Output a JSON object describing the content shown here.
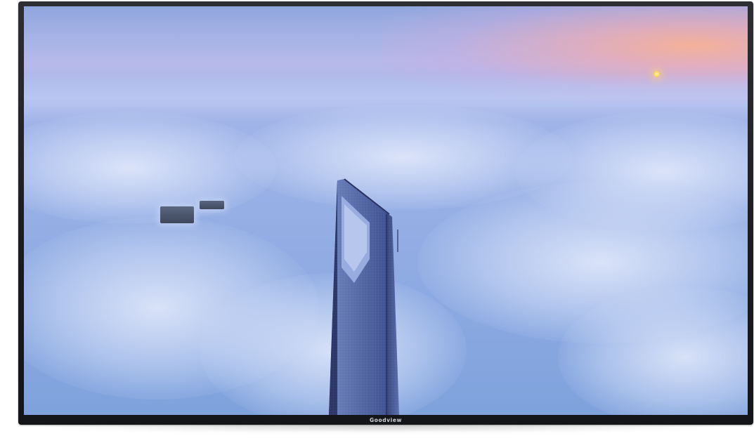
{
  "device": {
    "type": "wall-mounted display",
    "brand_logo": "Goodview",
    "bezel_color": "#1c1d20"
  },
  "screen": {
    "content": "wallpaper",
    "colors": {
      "sky_top": "#8fa6dd",
      "sunset_glow": "#f8b096",
      "cloud_sea": "#94aee4",
      "tower_glass": "#4a5e9c",
      "sun": "#ffd85a"
    },
    "icons": [
      "sun-icon",
      "skyscraper-icon"
    ]
  }
}
